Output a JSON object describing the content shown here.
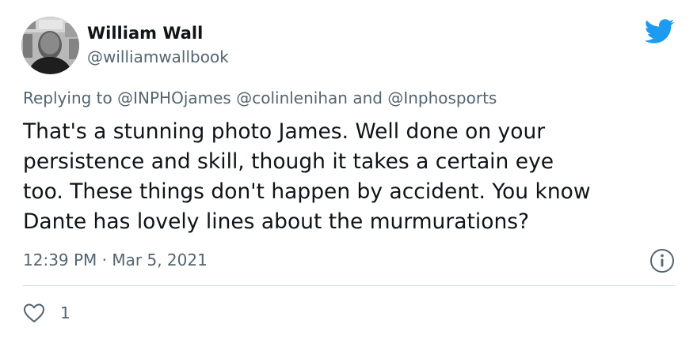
{
  "author": {
    "display_name": "William Wall",
    "handle": "@williamwallbook"
  },
  "reply": {
    "prefix": "Replying to",
    "mention_1": "@INPHOjames",
    "mention_2": "@colinlenihan",
    "conjunction": "and",
    "mention_3": "@Inphosports"
  },
  "tweet": {
    "text": "That's a stunning photo James. Well done on your\npersistence and skill, though it takes a certain eye\ntoo. These things don't happen by accident. You know\nDante has lovely lines about the murmurations?",
    "time": "12:39 PM",
    "separator": "·",
    "date": "Mar 5, 2021"
  },
  "engagement": {
    "like_count": "1"
  },
  "icons": {
    "brand": "twitter-bird-icon",
    "info": "info-icon",
    "like": "heart-outline-icon"
  },
  "colors": {
    "twitter_blue": "#1d9bf0",
    "text_primary": "#0f1419",
    "text_secondary": "#536471",
    "divider": "#cfd9de"
  }
}
